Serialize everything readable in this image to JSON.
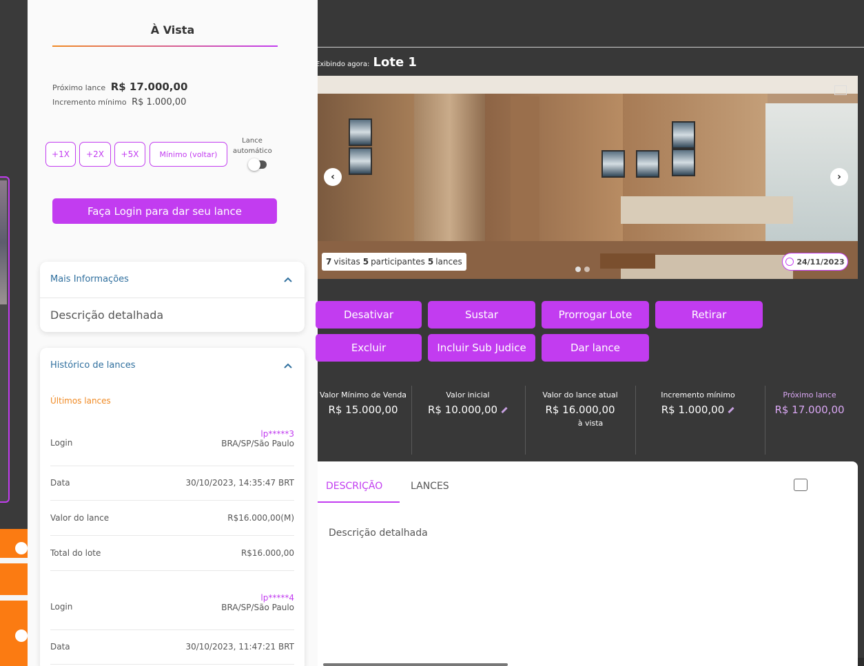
{
  "panel": {
    "title": "À Vista",
    "next_bid_label": "Próximo lance",
    "next_bid_value": "R$ 17.000,00",
    "min_inc_label": "Incremento mínimo",
    "min_inc_value": "R$ 1.000,00",
    "multipliers": [
      "+1X",
      "+2X",
      "+5X",
      "Mínimo (voltar)"
    ],
    "auto_bid_label_1": "Lance",
    "auto_bid_label_2": "automático",
    "auto_bid_on": false,
    "login_button": "Faça Login para dar seu lance",
    "more_info": {
      "title": "Mais Informações",
      "text": "Descrição detalhada"
    },
    "history": {
      "title": "Histórico de lances",
      "subtitle": "Últimos lances",
      "bids": [
        {
          "login_label": "Login",
          "user": "lp*****3",
          "location": "BRA/SP/São Paulo",
          "date_label": "Data",
          "date": "30/10/2023, 14:35:47 BRT",
          "value_label": "Valor do lance",
          "value": "R$16.000,00(M)",
          "total_label": "Total do lote",
          "total": "R$16.000,00"
        },
        {
          "login_label": "Login",
          "user": "lp*****4",
          "location": "BRA/SP/São Paulo",
          "date_label": "Data",
          "date": "30/10/2023, 11:47:21 BRT"
        }
      ]
    }
  },
  "main": {
    "now_prefix": "Exibindo agora:",
    "lot": "Lote 1",
    "stats": {
      "visits_n": "7",
      "visits_label": "visitas",
      "participants_n": "5",
      "participants_label": "participantes",
      "bids_n": "5",
      "bids_label": "lances"
    },
    "date_badge": "24/11/2023",
    "prev_arrow": "‹",
    "next_arrow": "›",
    "actions_row1": [
      "Desativar",
      "Sustar",
      "Prorrogar Lote",
      "Retirar"
    ],
    "actions_row2": [
      "Excluir",
      "Incluir Sub Judice",
      "Dar lance"
    ],
    "info": [
      {
        "label": "Valor Mínimo de Venda",
        "value": "R$ 15.000,00"
      },
      {
        "label": "Valor inicial",
        "value": "R$ 10.000,00"
      },
      {
        "label": "Valor do lance atual",
        "value": "R$ 16.000,00",
        "sub": "à vista"
      },
      {
        "label": "Incremento mínimo",
        "value": "R$ 1.000,00"
      },
      {
        "label": "Próximo lance",
        "value": "R$ 17.000,00"
      }
    ],
    "tabs": [
      "DESCRIÇÃO",
      "LANCES"
    ],
    "tab_content": "Descrição detalhada"
  },
  "colors": {
    "accent": "#c23cf0",
    "orange": "#f08a24",
    "background": "#383838"
  }
}
